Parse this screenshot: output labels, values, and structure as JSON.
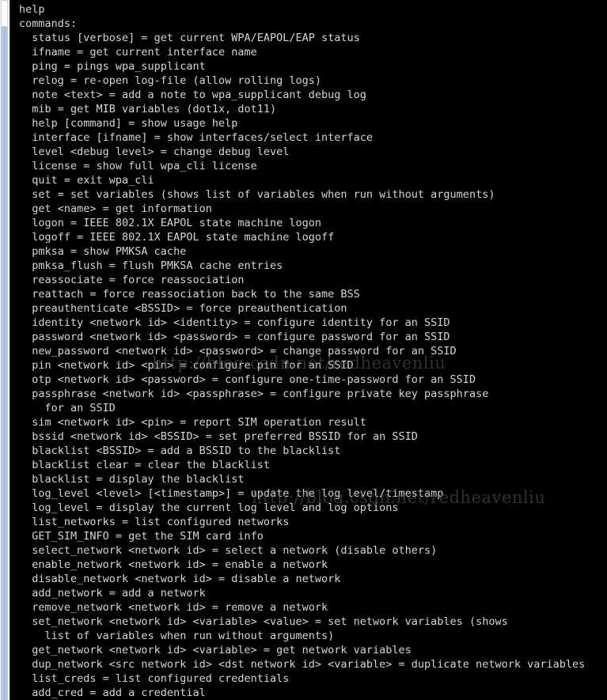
{
  "terminal": {
    "background_color": "#000000",
    "text_color": "#d3d7d3",
    "scrollbar_color": "#a8c4e0",
    "scrollbar_thumb_color": "#ffffff",
    "lines": [
      "help",
      "commands:",
      "  status [verbose] = get current WPA/EAPOL/EAP status",
      "  ifname = get current interface name",
      "  ping = pings wpa_supplicant",
      "  relog = re-open log-file (allow rolling logs)",
      "  note <text> = add a note to wpa_supplicant debug log",
      "  mib = get MIB variables (dot1x, dot11)",
      "  help [command] = show usage help",
      "  interface [ifname] = show interfaces/select interface",
      "  level <debug level> = change debug level",
      "  license = show full wpa_cli license",
      "  quit = exit wpa_cli",
      "  set = set variables (shows list of variables when run without arguments)",
      "  get <name> = get information",
      "  logon = IEEE 802.1X EAPOL state machine logon",
      "  logoff = IEEE 802.1X EAPOL state machine logoff",
      "  pmksa = show PMKSA cache",
      "  pmksa_flush = flush PMKSA cache entries",
      "  reassociate = force reassociation",
      "  reattach = force reassociation back to the same BSS",
      "  preauthenticate <BSSID> = force preauthentication",
      "  identity <network id> <identity> = configure identity for an SSID",
      "  password <network id> <password> = configure password for an SSID",
      "  new_password <network id> <password> = change password for an SSID",
      "  pin <network id> <pin> = configure pin for an SSID",
      "  otp <network id> <password> = configure one-time-password for an SSID",
      "  passphrase <network id> <passphrase> = configure private key passphrase",
      "    for an SSID",
      "  sim <network id> <pin> = report SIM operation result",
      "  bssid <network id> <BSSID> = set preferred BSSID for an SSID",
      "  blacklist <BSSID> = add a BSSID to the blacklist",
      "  blacklist clear = clear the blacklist",
      "  blacklist = display the blacklist",
      "  log_level <level> [<timestamp>] = update the log level/timestamp",
      "  log_level = display the current log level and log options",
      "  list_networks = list configured networks",
      "  GET_SIM_INFO = get the SIM card info",
      "  select_network <network id> = select a network (disable others)",
      "  enable_network <network id> = enable a network",
      "  disable_network <network id> = disable a network",
      "  add_network = add a network",
      "  remove_network <network id> = remove a network",
      "  set_network <network id> <variable> <value> = set network variables (shows",
      "    list of variables when run without arguments)",
      "  get_network <network id> <variable> = get network variables",
      "  dup_network <src network id> <dst network id> <variable> = duplicate network variables",
      "  list_creds = list configured credentials",
      "  add_cred = add a credential"
    ]
  },
  "watermarks": {
    "upper": "http://blog.csdn.net/redheavenliu",
    "lower": "http://blog.csdn.net/redheavenliu"
  }
}
